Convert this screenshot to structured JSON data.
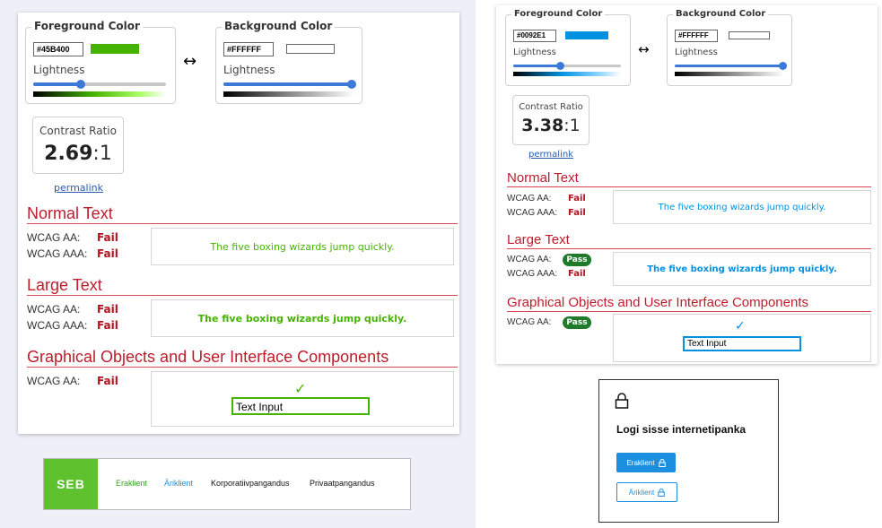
{
  "left": {
    "foreground": {
      "legend": "Foreground Color",
      "hex": "#45B400",
      "lightness_label": "Lightness",
      "lightness_value": 0.36,
      "color": "#45B400"
    },
    "background": {
      "legend": "Background Color",
      "hex": "#FFFFFF",
      "lightness_label": "Lightness",
      "lightness_value": 1.0,
      "color": "#FFFFFF"
    },
    "swap_symbol": "↔",
    "contrast": {
      "label": "Contrast Ratio",
      "value": "2.69",
      "suffix": ":1"
    },
    "permalink": "permalink",
    "normal": {
      "heading": "Normal Text",
      "aa_label": "WCAG AA:",
      "aa_result": "Fail",
      "aaa_label": "WCAG AAA:",
      "aaa_result": "Fail",
      "sample": "The five boxing wizards jump quickly."
    },
    "large": {
      "heading": "Large Text",
      "aa_label": "WCAG AA:",
      "aa_result": "Fail",
      "aaa_label": "WCAG AAA:",
      "aaa_result": "Fail",
      "sample": "The five boxing wizards jump quickly."
    },
    "graphical": {
      "heading": "Graphical Objects and User Interface Components",
      "aa_label": "WCAG AA:",
      "aa_result": "Fail",
      "check": "✓",
      "input_value": "Text Input"
    }
  },
  "seb": {
    "logo": "SEB",
    "nav": [
      "Eraklient",
      "Äriklient",
      "Korporatiivpangandus",
      "Privaatpangandus"
    ],
    "brand_color": "#5EC12D"
  },
  "right": {
    "foreground": {
      "legend": "Foreground Color",
      "hex": "#0092E1",
      "lightness_label": "Lightness",
      "lightness_value": 0.43,
      "color": "#0092E1"
    },
    "background": {
      "legend": "Background Color",
      "hex": "#FFFFFF",
      "lightness_label": "Lightness",
      "lightness_value": 1.0,
      "color": "#FFFFFF"
    },
    "swap_symbol": "↔",
    "contrast": {
      "label": "Contrast Ratio",
      "value": "3.38",
      "suffix": ":1"
    },
    "permalink": "permalink",
    "normal": {
      "heading": "Normal Text",
      "aa_label": "WCAG AA:",
      "aa_result": "Fail",
      "aaa_label": "WCAG AAA:",
      "aaa_result": "Fail",
      "sample": "The five boxing wizards jump quickly."
    },
    "large": {
      "heading": "Large Text",
      "aa_label": "WCAG AA:",
      "aa_result": "Pass",
      "aaa_label": "WCAG AAA:",
      "aaa_result": "Fail",
      "sample": "The five boxing wizards jump quickly."
    },
    "graphical": {
      "heading": "Graphical Objects and User Interface Components",
      "aa_label": "WCAG AA:",
      "aa_result": "Pass",
      "check": "✓",
      "input_value": "Text Input"
    }
  },
  "login": {
    "title": "Logi sisse internetipanka",
    "primary": "Eraklient",
    "secondary": "Äriklient",
    "icon": "lock-icon",
    "accent": "#1D8FE0"
  }
}
